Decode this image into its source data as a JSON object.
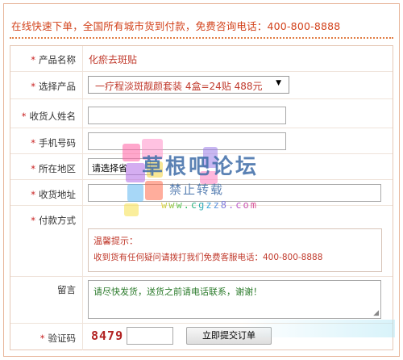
{
  "banner": {
    "text": "在线快速下单，全国所有城市货到付款，免费咨询电话：400-800-8888"
  },
  "form": {
    "required_mark": "*",
    "rows": {
      "product_name": {
        "label": "产品名称",
        "value": "化瘀去斑贴"
      },
      "select_product": {
        "label": "选择产品",
        "selected": "一疗程淡斑靓颜套装 4盒=24贴 488元",
        "arrow": "▼"
      },
      "receiver_name": {
        "label": "收货人姓名",
        "value": ""
      },
      "phone": {
        "label": "手机号码",
        "value": ""
      },
      "region": {
        "label": "所在地区",
        "selected": "请选择省"
      },
      "address": {
        "label": "收货地址",
        "value": ""
      },
      "payment": {
        "label": "付款方式",
        "tip_title": "温馨提示：",
        "tip_text": "收到货有任何疑问请拨打我们免费客服电话：400-800-8888"
      },
      "message": {
        "label": "留言",
        "value": "请尽快发货，送货之前请电话联系，谢谢！"
      },
      "captcha": {
        "label": "验证码",
        "code": "8479",
        "value": "",
        "submit_label": "立即提交订单"
      }
    }
  },
  "watermark": {
    "title": "草根吧论坛",
    "subtitle": "禁止转载",
    "url": "www.cgzz8.com"
  },
  "colors": {
    "banner_text": "#d2411a",
    "required_star": "#c81e1e",
    "value_red": "#c0392b",
    "message_green": "#2a7a2a",
    "watermark_blue": "#3f6da8"
  }
}
